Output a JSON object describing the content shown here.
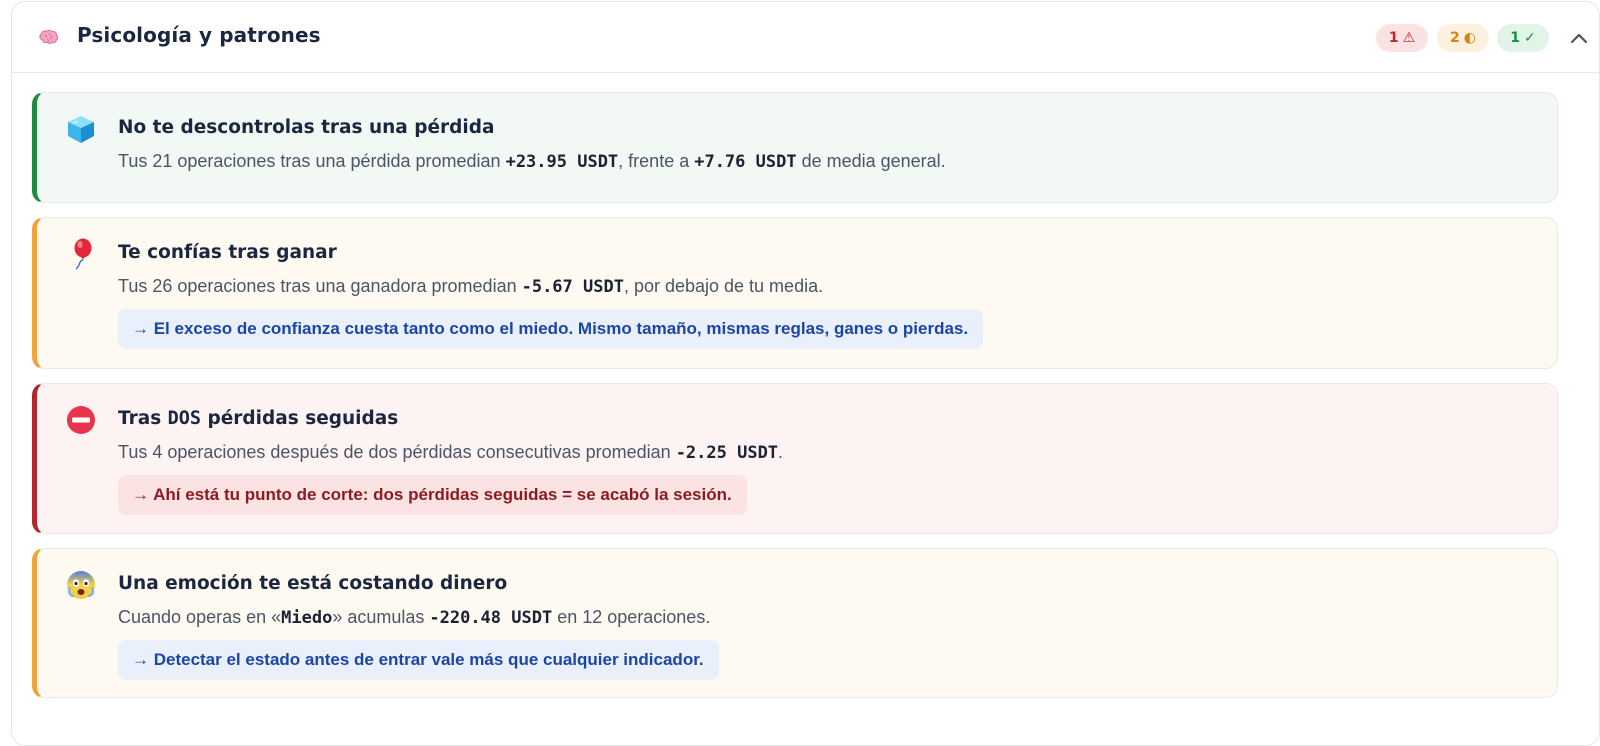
{
  "header": {
    "title": "Psicología y patrones",
    "icon": "brain-icon",
    "badges": [
      {
        "count": "1",
        "symbol": "⚠",
        "color": "#c0262d"
      },
      {
        "count": "2",
        "symbol": "◐",
        "color": "#d9820f"
      },
      {
        "count": "1",
        "symbol": "✓",
        "color": "#208a43"
      }
    ]
  },
  "cards": [
    {
      "status": "positive",
      "icon": "ice-cube-icon",
      "title": "No te descontrolas tras una pérdida",
      "text_1": "Tus 21 operaciones tras una pérdida promedian ",
      "value_1": "+23.95 USDT",
      "text_2": ", frente a ",
      "value_2": "+7.76 USDT",
      "text_3": " de media general."
    },
    {
      "status": "warning",
      "icon": "balloon-icon",
      "title": "Te confías tras ganar",
      "text_1": "Tus 26 operaciones tras una ganadora promedian ",
      "value_1": "-5.67 USDT",
      "text_2": ", por debajo de tu media.",
      "tip": "→ El exceso de confianza cuesta tanto como el miedo. Mismo tamaño, mismas reglas, ganes o pierdas."
    },
    {
      "status": "negative",
      "icon": "no-entry-icon",
      "title_1": "Tras ",
      "title_mono": "DOS",
      "title_2": " pérdidas seguidas",
      "text_1": "Tus 4 operaciones después de dos pérdidas consecutivas promedian ",
      "value_1": "-2.25 USDT",
      "text_2": ".",
      "tip": "→ Ahí está tu punto de corte: dos pérdidas seguidas = se acabó la sesión."
    },
    {
      "status": "warning",
      "icon": "fearful-face-icon",
      "title": "Una emoción te está costando dinero",
      "text_1": "Cuando operas en «",
      "emotion": "Miedo",
      "text_2": "» acumulas ",
      "value_1": "-220.48 USDT",
      "text_3": " en 12 operaciones.",
      "tip": "→ Detectar el estado antes de entrar vale más que cualquier indicador."
    }
  ],
  "colors": {
    "positive": "#1e8c3f",
    "warning": "#f0a53a",
    "negative": "#b3262e",
    "tip_blue_text": "#1b45a6",
    "tip_red_text": "#8d1a1e"
  }
}
